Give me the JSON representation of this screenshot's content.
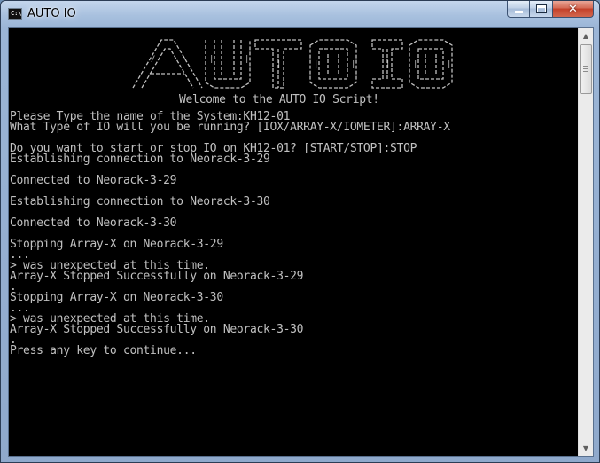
{
  "window": {
    "title": "AUTO IO",
    "icon": "console-icon",
    "icon_text": "C:\\",
    "controls": [
      "minimize-button",
      "maximize-button",
      "close-button"
    ]
  },
  "console": {
    "banner_art_text": "AUTO IO",
    "welcome": "Welcome to the AUTO IO Script!",
    "lines": [
      "Please Type the name of the System:KH12-01",
      "What Type of IO will you be running? [IOX/ARRAY-X/IOMETER]:ARRAY-X",
      "",
      "Do you want to start or stop IO on KH12-01? [START/STOP]:STOP",
      "Establishing connection to Neorack-3-29",
      "",
      "Connected to Neorack-3-29",
      "",
      "Establishing connection to Neorack-3-30",
      "",
      "Connected to Neorack-3-30",
      "",
      "Stopping Array-X on Neorack-3-29",
      "...",
      "> was unexpected at this time.",
      "Array-X Stopped Successfully on Neorack-3-29",
      ".",
      "Stopping Array-X on Neorack-3-30",
      "...",
      "> was unexpected at this time.",
      "Array-X Stopped Successfully on Neorack-3-30",
      ".",
      "Press any key to continue..."
    ]
  },
  "colors": {
    "console_bg": "#000000",
    "console_fg": "#c0c0c0",
    "close_button": "#c4412a"
  }
}
